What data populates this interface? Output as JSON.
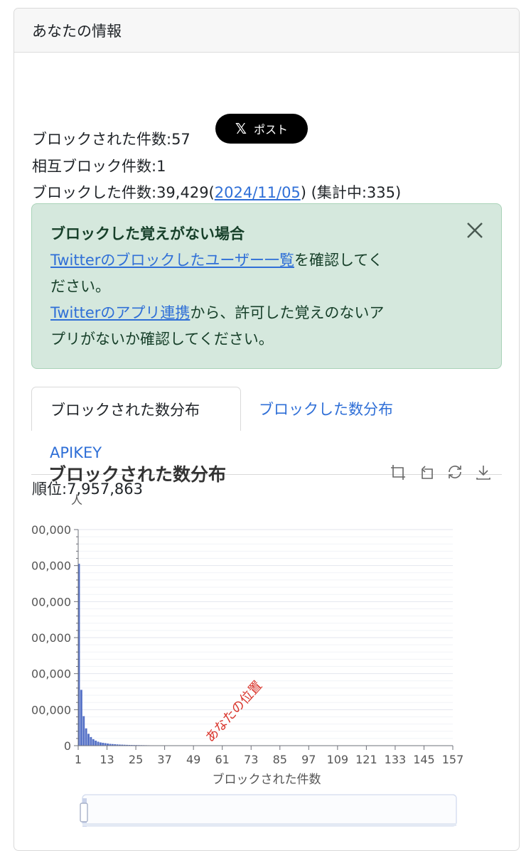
{
  "header": {
    "title": "あなたの情報"
  },
  "stats": {
    "blocked_by_label": "ブロックされた件数:57",
    "post_label": "ポスト",
    "mutual_label": "相互ブロック件数:1",
    "blocking_prefix": "ブロックした件数:39,429(",
    "blocking_date": "2024/11/05",
    "blocking_suffix": ") (集計中:335)"
  },
  "alert": {
    "title": "ブロックした覚えがない場合",
    "line1_link": "Twitterのブロックしたユーザー一覧",
    "line1_rest": "を確認してく",
    "line2": "ださい。",
    "line3_link": "Twitterのアプリ連携",
    "line3_rest": "から、許可した覚えのないア",
    "line4": "プリがないか確認してください。"
  },
  "tabs": [
    {
      "label": "ブロックされた数分布",
      "active": true
    },
    {
      "label": "ブロックした数分布",
      "active": false
    },
    {
      "label": "APIKEY",
      "active": false
    }
  ],
  "rank": {
    "label": "順位:7,957,863"
  },
  "chart": {
    "title": "ブロックされた数分布",
    "tools": [
      "zoom-icon",
      "zoom-reset-icon",
      "restore-icon",
      "download-icon"
    ]
  },
  "chart_data": {
    "type": "bar",
    "title": "ブロックされた数分布",
    "xlabel": "ブロックされた件数",
    "ylabel": "人",
    "x_ticks": [
      "1",
      "13",
      "25",
      "37",
      "49",
      "61",
      "73",
      "85",
      "97",
      "109",
      "121",
      "133",
      "145",
      "157"
    ],
    "y_ticks": [
      "0",
      "00,000",
      "00,000",
      "00,000",
      "00,000",
      "00,000",
      "00,000"
    ],
    "ylim": [
      0,
      6
    ],
    "y_unit_note": "",
    "x": [
      1,
      2,
      3,
      4,
      5,
      6,
      7,
      8,
      9,
      10,
      11,
      12,
      13,
      14,
      15,
      16,
      17,
      18,
      19,
      20,
      21,
      22,
      23,
      24,
      25,
      26,
      27,
      28,
      29,
      30,
      31,
      32,
      33,
      34,
      35,
      36,
      37,
      38,
      39,
      40,
      41,
      42,
      43,
      44,
      45,
      46,
      47,
      48,
      49,
      50,
      51,
      52,
      53,
      54,
      55,
      56,
      57
    ],
    "values": [
      5.05,
      1.55,
      0.82,
      0.48,
      0.33,
      0.24,
      0.18,
      0.14,
      0.11,
      0.09,
      0.08,
      0.07,
      0.06,
      0.05,
      0.045,
      0.04,
      0.035,
      0.03,
      0.028,
      0.025,
      0.022,
      0.02,
      0.018,
      0.017,
      0.016,
      0.015,
      0.014,
      0.013,
      0.012,
      0.011,
      0.01,
      0.01,
      0.009,
      0.009,
      0.008,
      0.008,
      0.007,
      0.007,
      0.006,
      0.006,
      0.006,
      0.005,
      0.005,
      0.005,
      0.004,
      0.004,
      0.004,
      0.004,
      0.003,
      0.003,
      0.003,
      0.003,
      0.003,
      0.003,
      0.002,
      0.002,
      0.002
    ],
    "annotation": {
      "text": "あなたの位置",
      "x": 57,
      "color": "#d9342b"
    },
    "bar_color": "#5470c6",
    "grid": true,
    "dataZoom": true
  }
}
